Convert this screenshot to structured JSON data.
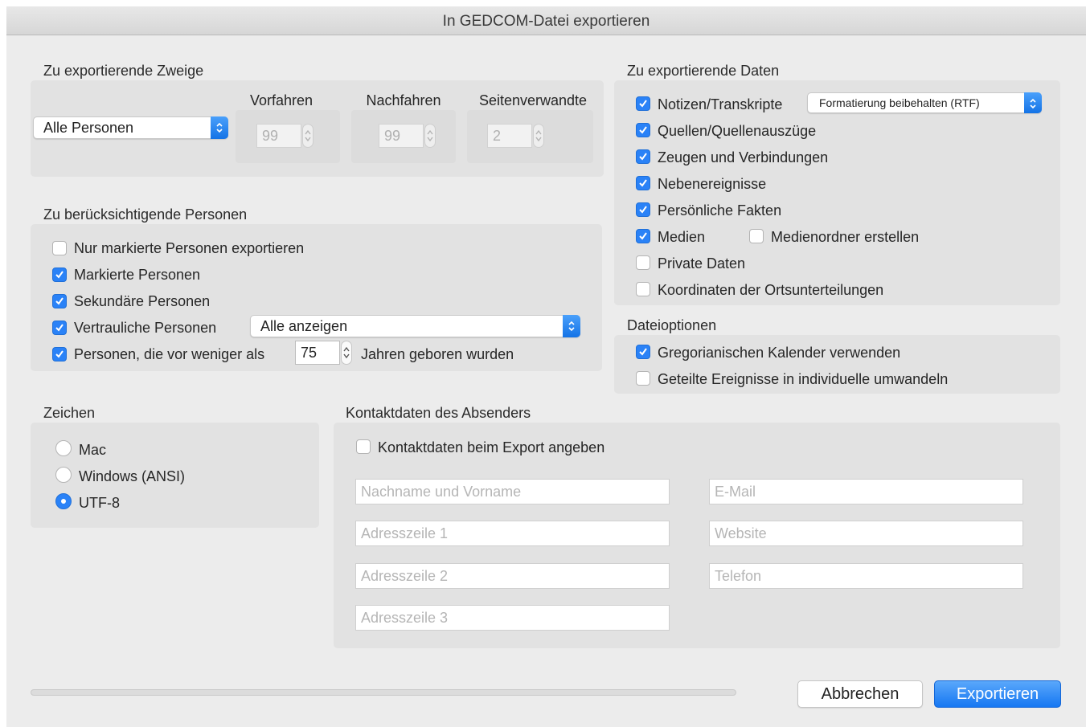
{
  "window": {
    "title": "In GEDCOM-Datei exportieren"
  },
  "branches": {
    "title": "Zu exportierende Zweige",
    "selection": "Alle Personen",
    "ancestors": {
      "label": "Vorfahren",
      "value": "99"
    },
    "descendants": {
      "label": "Nachfahren",
      "value": "99"
    },
    "collateral": {
      "label": "Seitenverwandte",
      "value": "2"
    }
  },
  "persons": {
    "title": "Zu berücksichtigende Personen",
    "only_marked": {
      "label": "Nur markierte Personen exportieren",
      "checked": false
    },
    "marked": {
      "label": "Markierte Personen",
      "checked": true
    },
    "secondary": {
      "label": "Sekundäre Personen",
      "checked": true
    },
    "confidential": {
      "label": "Vertrauliche Personen",
      "checked": true,
      "select_value": "Alle anzeigen"
    },
    "born_within": {
      "label_before": "Personen, die vor weniger als",
      "value": "75",
      "label_after": "Jahren geboren wurden",
      "checked": true
    }
  },
  "charset": {
    "title": "Zeichen",
    "options": [
      {
        "label": "Mac",
        "selected": false
      },
      {
        "label": "Windows (ANSI)",
        "selected": false
      },
      {
        "label": "UTF-8",
        "selected": true
      }
    ]
  },
  "data_export": {
    "title": "Zu exportierende Daten",
    "notes_format": "Formatierung beibehalten (RTF)",
    "items": [
      {
        "label": "Notizen/Transkripte",
        "checked": true
      },
      {
        "label": "Quellen/Quellenauszüge",
        "checked": true
      },
      {
        "label": "Zeugen und Verbindungen",
        "checked": true
      },
      {
        "label": "Nebenereignisse",
        "checked": true
      },
      {
        "label": "Persönliche Fakten",
        "checked": true
      },
      {
        "label": "Medien",
        "checked": true
      },
      {
        "label": "Private Daten",
        "checked": false
      },
      {
        "label": "Koordinaten der Ortsunterteilungen",
        "checked": false
      }
    ],
    "media_folder": {
      "label": "Medienordner erstellen",
      "checked": false
    }
  },
  "file_options": {
    "title": "Dateioptionen",
    "gregorian": {
      "label": "Gregorianischen Kalender verwenden",
      "checked": true
    },
    "split_events": {
      "label": "Geteilte Ereignisse in individuelle umwandeln",
      "checked": false
    }
  },
  "contact": {
    "title": "Kontaktdaten des Absenders",
    "include": {
      "label": "Kontaktdaten beim Export angeben",
      "checked": false
    },
    "placeholders": {
      "name": "Nachname und Vorname",
      "email": "E-Mail",
      "address1": "Adresszeile 1",
      "website": "Website",
      "address2": "Adresszeile 2",
      "phone": "Telefon",
      "address3": "Adresszeile 3"
    }
  },
  "buttons": {
    "cancel": "Abbrechen",
    "export": "Exportieren"
  },
  "colors": {
    "accent": "#2a82f7",
    "panel": "#e2e2e2",
    "window": "#ececec"
  }
}
